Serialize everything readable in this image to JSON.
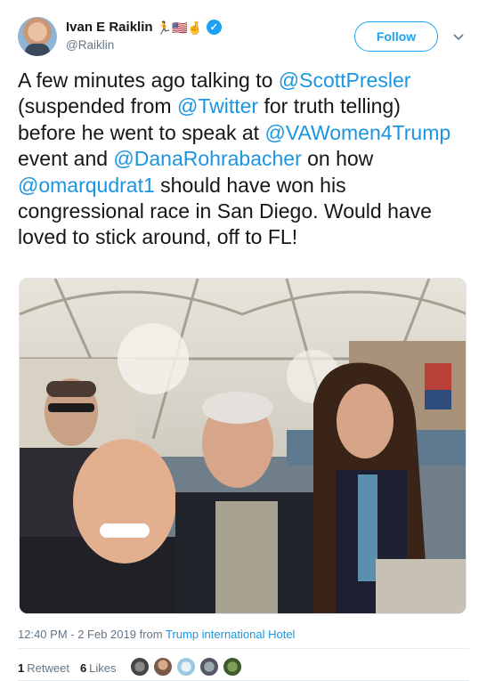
{
  "author": {
    "name": "Ivan E Raiklin",
    "handle": "@Raiklin",
    "name_emojis": "🏃🇺🇸🤞",
    "avatar_icon": "profile-photo"
  },
  "follow_label": "Follow",
  "tweet": {
    "t1": "A few minutes ago talking to ",
    "m1": "@ScottPresler",
    "t2": " (suspended from ",
    "m2": "@Twitter",
    "t3": " for truth telling) before he went to speak at ",
    "m3": "@VAWomen4Trump",
    "t4": " event and ",
    "m4": "@DanaRohrabacher",
    "t5": " on how ",
    "m5": "@omarqudrat1",
    "t6": " should have won his congressional race in San Diego.  Would have loved to stick around, off to FL!"
  },
  "timestamp": {
    "time": "12:40 PM - 2 Feb 2019 from ",
    "place": "Trump international Hotel"
  },
  "stats": {
    "retweets_count": "1",
    "retweets_label": "Retweet",
    "likes_count": "6",
    "likes_label": "Likes"
  },
  "colors": {
    "accent": "#1da1f2",
    "link": "#1b95e0",
    "secondary_text": "#657786"
  }
}
